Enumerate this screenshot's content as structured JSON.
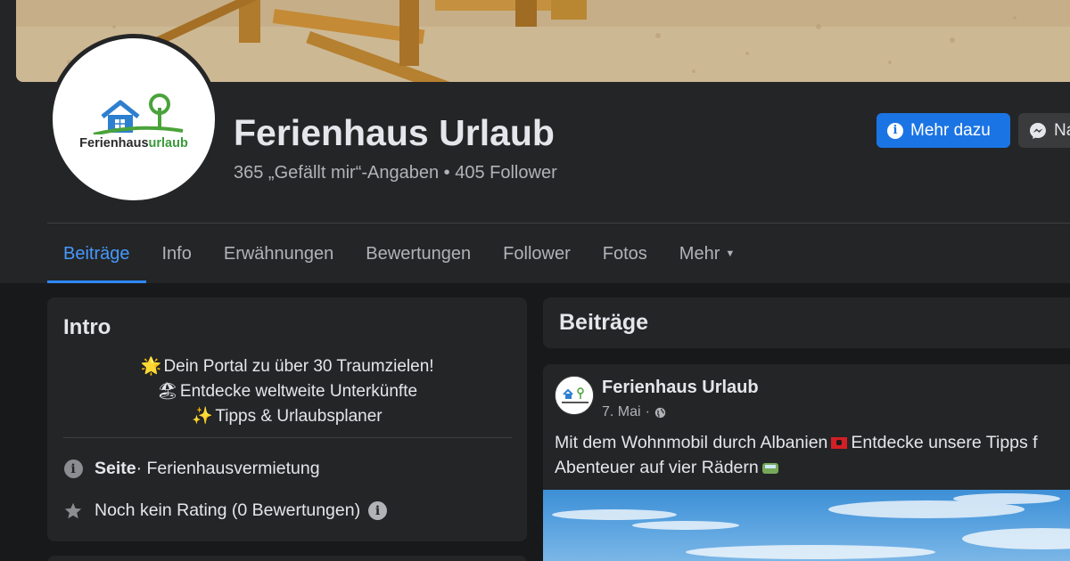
{
  "page": {
    "name": "Ferienhaus Urlaub",
    "stats": "365 „Gefällt mir“-Angaben • 405 Follower",
    "logo_wordmark_a": "Ferienhaus",
    "logo_wordmark_b": "urlaub"
  },
  "actions": {
    "more_label": "Mehr dazu",
    "message_label": "Na"
  },
  "tabs": [
    {
      "label": "Beiträge",
      "active": true
    },
    {
      "label": "Info"
    },
    {
      "label": "Erwähnungen"
    },
    {
      "label": "Bewertungen"
    },
    {
      "label": "Follower"
    },
    {
      "label": "Fotos"
    },
    {
      "label": "Mehr"
    }
  ],
  "intro": {
    "title": "Intro",
    "bio": [
      {
        "emoji": "🌟",
        "text": "Dein Portal zu über 30 Traumzielen!"
      },
      {
        "emoji": "🏖",
        "text": "Entdecke weltweite Unterkünfte"
      },
      {
        "emoji": "✨",
        "text": "Tipps & Urlaubsplaner"
      }
    ],
    "category_label": "Seite",
    "category_value": " · Ferienhausvermietung",
    "rating_text": "Noch kein Rating (0 Bewertungen)"
  },
  "posts": {
    "header": "Beiträge",
    "items": [
      {
        "author": "Ferienhaus Urlaub",
        "date": "7. Mai",
        "separator": " · ",
        "text_part1": "Mit dem Wohnmobil durch Albanien",
        "text_part2": "Entdecke unsere Tipps f",
        "text_line2": "Abenteuer auf vier Rädern"
      }
    ]
  },
  "colors": {
    "accent": "#1b74e4",
    "active_tab": "#4599ff",
    "card_bg": "#242526",
    "page_bg": "#18191a"
  },
  "icons": {
    "more_button_icon": "info-icon",
    "message_button_icon": "messenger-icon",
    "category_icon": "info-icon",
    "rating_icon": "star-icon",
    "post_visibility_icon": "globe-icon",
    "tab_more_icon": "caret-down-icon"
  }
}
